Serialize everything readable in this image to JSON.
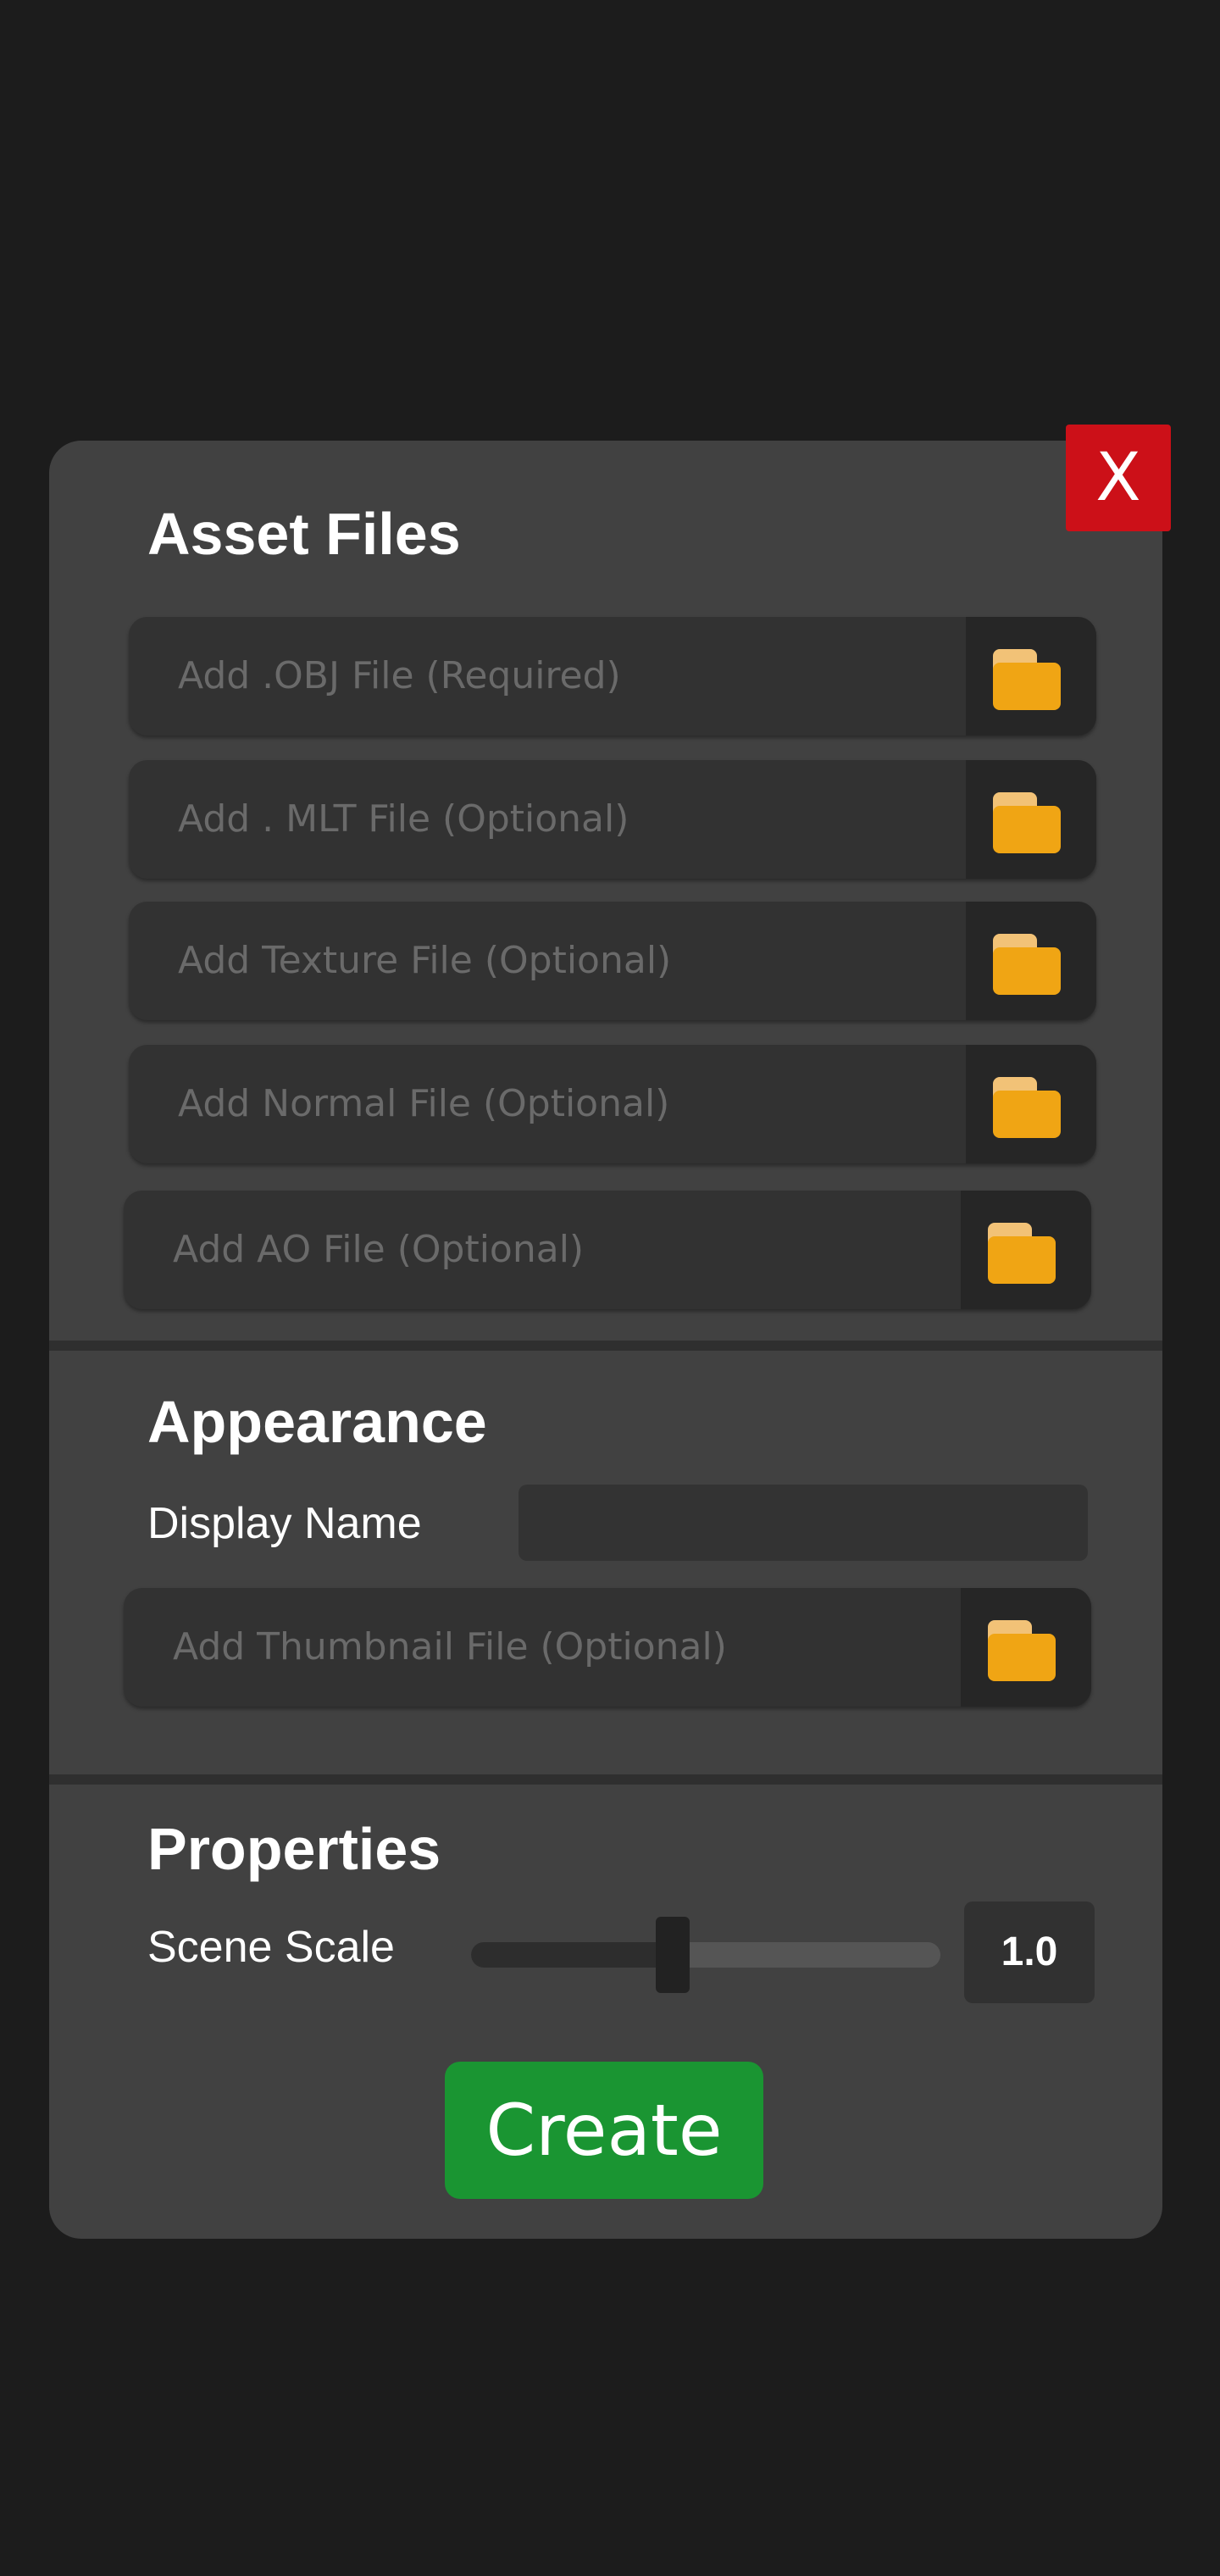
{
  "dialog": {
    "close_label": "X"
  },
  "asset_files": {
    "title": "Asset Files",
    "rows": [
      {
        "placeholder": "Add .OBJ File (Required)",
        "icon": "folder-icon"
      },
      {
        "placeholder": "Add . MLT File (Optional)",
        "icon": "folder-icon"
      },
      {
        "placeholder": "Add Texture File (Optional)",
        "icon": "folder-icon"
      },
      {
        "placeholder": "Add Normal File (Optional)",
        "icon": "folder-icon"
      },
      {
        "placeholder": "Add AO File (Optional)",
        "icon": "folder-icon"
      }
    ]
  },
  "appearance": {
    "title": "Appearance",
    "display_name_label": "Display Name",
    "display_name_value": "",
    "thumbnail_placeholder": "Add Thumbnail File (Optional)"
  },
  "properties": {
    "title": "Properties",
    "scene_scale_label": "Scene Scale",
    "scene_scale_value": "1.0",
    "slider_fraction": 0.43
  },
  "actions": {
    "create_label": "Create"
  },
  "colors": {
    "background": "#1c1c1c",
    "panel": "#414141",
    "close_red": "#cc1018",
    "create_green": "#1a9532",
    "folder_orange": "#f0a514"
  }
}
